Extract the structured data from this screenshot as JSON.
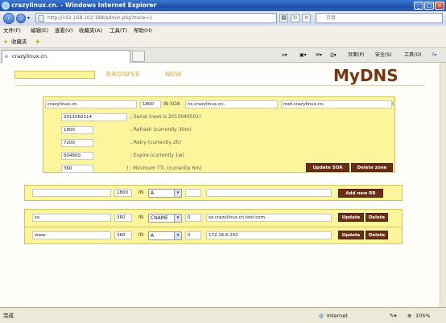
{
  "window": {
    "title": "crazylinux.cn. - Windows Internet Explorer"
  },
  "address": {
    "url": "http://192.168.102.188/admin.php?zone=1"
  },
  "search": {
    "placeholder": "百度"
  },
  "menu": {
    "items": [
      "文件(F)",
      "编辑(E)",
      "查看(V)",
      "收藏夹(A)",
      "工具(T)",
      "帮助(H)"
    ]
  },
  "favorites": {
    "label": "收藏夹"
  },
  "tab": {
    "title": "crazylinux.cn."
  },
  "commandbar": {
    "page": "页面(P)",
    "safety": "安全(S)",
    "tools": "工具(O)"
  },
  "nav": {
    "browse": "BROWSE",
    "new": "NEW",
    "logo": "MyDNS"
  },
  "soa": {
    "origin": "crazylinux.cn.",
    "ttl": "1800",
    "in_soa": "IN SOA",
    "ns": "ns.crazylinux.cn.",
    "mbox": "root.crazylinux.cn.",
    "paren": "(",
    "serial": "2011060114",
    "serial_label": "; Serial (next is 2013040501)",
    "refresh": "1800",
    "refresh_label": "; Refresh (currently 30m)",
    "retry": "7200",
    "retry_label": "; Retry (currently 2h)",
    "expire": "604800",
    "expire_label": "; Expire (currently 1w)",
    "minimum": "360",
    "minimum_label": ") ; Minimum TTL (currently 6m)",
    "update_btn": "Update SOA",
    "delete_btn": "Delete zone"
  },
  "new_rr": {
    "name": "",
    "ttl": "1800",
    "class": "IN",
    "type": "A",
    "aux": "",
    "data": "",
    "add_btn": "Add new RR"
  },
  "records": [
    {
      "name": "so",
      "ttl": "360",
      "class": "IN",
      "type": "CNAME",
      "aux": "0",
      "data": "so.crazylinux.cn.test.com.",
      "update": "Update",
      "delete": "Delete"
    },
    {
      "name": "www",
      "ttl": "360",
      "class": "IN",
      "type": "A",
      "aux": "0",
      "data": "172.16.6.202",
      "update": "Update",
      "delete": "Delete"
    }
  ],
  "status": {
    "left": "完成",
    "zone": "Internet",
    "zoom": "105%"
  },
  "colors": {
    "panel": "#fdf59c",
    "button": "#6b2e12",
    "nav_text": "#e9c77a",
    "logo": "#7a3410"
  }
}
